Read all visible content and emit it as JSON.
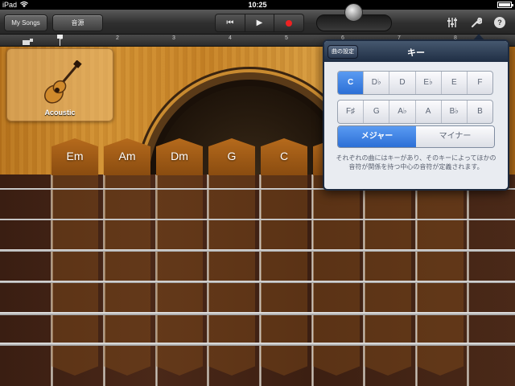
{
  "status": {
    "device": "iPad",
    "time": "10:25"
  },
  "toolbar": {
    "my_songs": "My Songs",
    "sound_source": "音源"
  },
  "ruler": {
    "marks": [
      "1",
      "2",
      "3",
      "4",
      "5",
      "6",
      "7",
      "8"
    ]
  },
  "instrument": {
    "name": "Acoustic"
  },
  "chords": [
    "Em",
    "Am",
    "Dm",
    "G",
    "C"
  ],
  "popover": {
    "back_label": "曲の設定",
    "title": "キー",
    "keys_row1": [
      "C",
      "D♭",
      "D",
      "E♭",
      "E",
      "F"
    ],
    "keys_row2": [
      "F♯",
      "G",
      "A♭",
      "A",
      "B♭",
      "B"
    ],
    "selected_key": "C",
    "major": "メジャー",
    "minor": "マイナー",
    "description": "それぞれの曲にはキーがあり、そのキーによってほかの音符が関係を持つ中心の音符が定義されます。"
  },
  "colors": {
    "accent_blue": "#2c6fd6",
    "record_red": "#e22222"
  }
}
